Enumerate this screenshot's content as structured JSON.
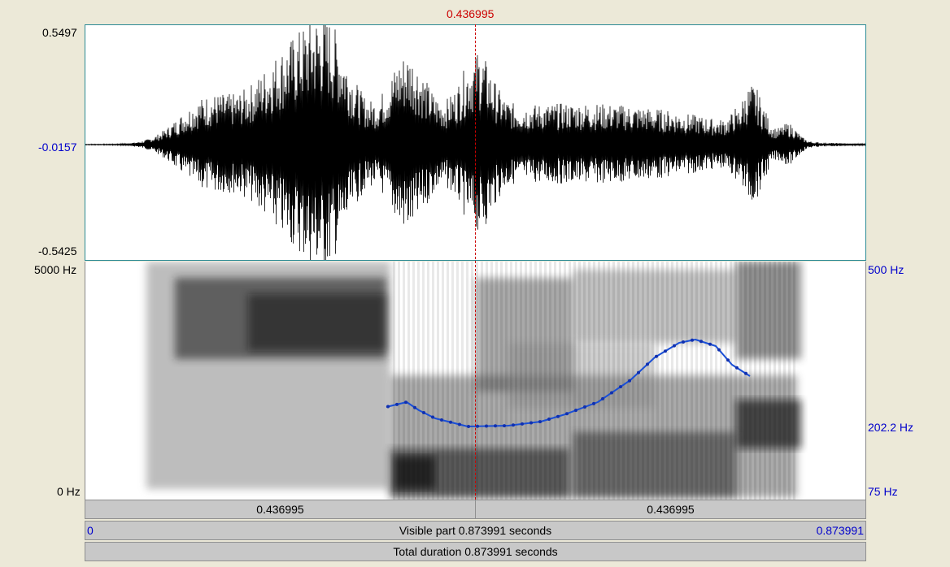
{
  "cursor": {
    "time_label": "0.436995"
  },
  "waveform": {
    "y_max": "0.5497",
    "y_mid": "-0.0157",
    "y_min": "-0.5425"
  },
  "spectrogram": {
    "freq_top": "5000 Hz",
    "freq_bottom": "0 Hz",
    "pitch_top": "500 Hz",
    "pitch_mid": "202.2 Hz",
    "pitch_bottom": "75 Hz"
  },
  "selection_bar": {
    "left_label": "0.436995",
    "right_label": "0.436995"
  },
  "visible_bar": {
    "start": "0",
    "text": "Visible part 0.873991 seconds",
    "end": "0.873991"
  },
  "total_bar": {
    "text": "Total duration 0.873991 seconds"
  },
  "colors": {
    "cursor": "#cc0000",
    "pitch": "#1a4fd6",
    "axis_blue": "#0000cc"
  }
}
